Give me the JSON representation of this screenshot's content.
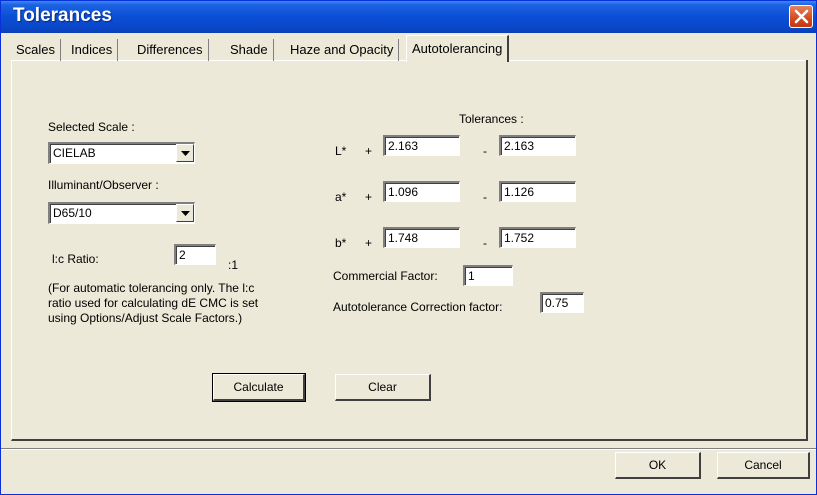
{
  "window": {
    "title": "Tolerances"
  },
  "tabs": [
    {
      "label": "Scales"
    },
    {
      "label": "Indices"
    },
    {
      "label": "Differences"
    },
    {
      "label": "Shade"
    },
    {
      "label": "Haze and Opacity"
    },
    {
      "label": "Autotolerancing"
    }
  ],
  "active_tab": "Autotolerancing",
  "left": {
    "selected_scale_label": "Selected Scale :",
    "selected_scale_value": "CIELAB",
    "illuminant_label": "Illuminant/Observer :",
    "illuminant_value": "D65/10",
    "lc_ratio_label": "l:c Ratio:",
    "lc_ratio_value": "2",
    "lc_ratio_suffix": ":1",
    "note_line1": "(For automatic tolerancing only.  The l:c",
    "note_line2": "ratio used for calculating dE CMC is set",
    "note_line3": "using Options/Adjust Scale Factors.)"
  },
  "tolerances": {
    "header": "Tolerances :",
    "plus_sign": "+",
    "minus_sign": "-",
    "rows": [
      {
        "label": "L*",
        "plus": "2.163",
        "minus": "2.163"
      },
      {
        "label": "a*",
        "plus": "1.096",
        "minus": "1.126"
      },
      {
        "label": "b*",
        "plus": "1.748",
        "minus": "1.752"
      }
    ],
    "commercial_factor_label": "Commercial Factor:",
    "commercial_factor_value": "1",
    "autotolerance_label": "Autotolerance Correction factor:",
    "autotolerance_value": "0.75"
  },
  "buttons": {
    "calculate": "Calculate",
    "clear": "Clear",
    "ok": "OK",
    "cancel": "Cancel"
  },
  "colors": {
    "titlebar": "#0b4ed6",
    "dialog_face": "#ece9d8",
    "close_button": "#d4491f"
  }
}
